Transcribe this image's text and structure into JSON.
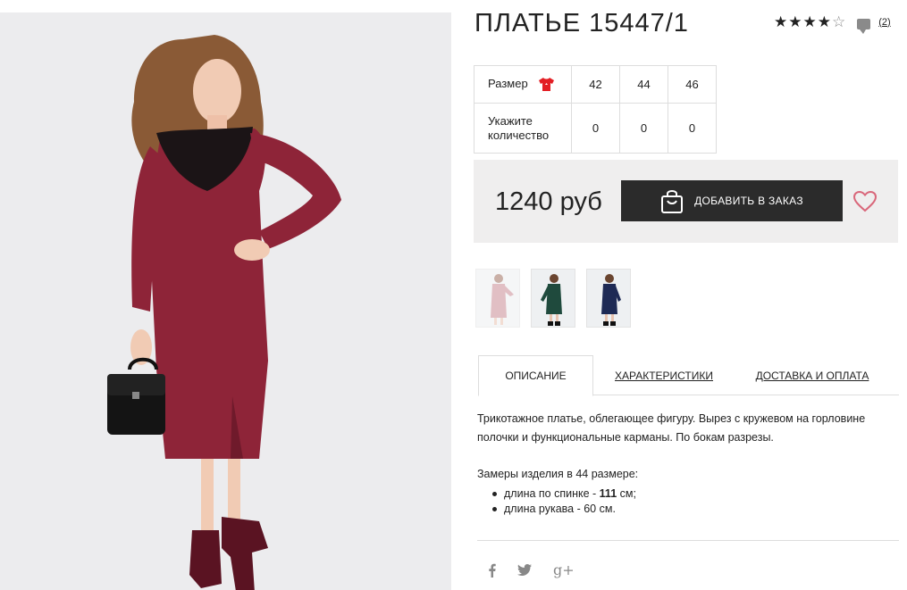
{
  "product": {
    "title": "ПЛАТЬЕ 15447/1",
    "rating": 4,
    "rating_max": 5,
    "review_count": "(2)"
  },
  "sizes": {
    "size_label": "Размер",
    "quantity_label_1": "Укажите",
    "quantity_label_2": "количество",
    "options": [
      {
        "size": "42",
        "qty": "0"
      },
      {
        "size": "44",
        "qty": "0"
      },
      {
        "size": "46",
        "qty": "0"
      }
    ]
  },
  "buy": {
    "price": "1240 руб",
    "add_label": "ДОБАВИТЬ В ЗАКАЗ"
  },
  "thumbnails": [
    {
      "color_name": "pink",
      "color": "#c98b95"
    },
    {
      "color_name": "green",
      "color": "#1f4a3d"
    },
    {
      "color_name": "navy",
      "color": "#1e2a55"
    }
  ],
  "tabs": {
    "description": "ОПИСАНИЕ",
    "characteristics": "ХАРАКТЕРИСТИКИ",
    "delivery": "ДОСТАВКА И ОПЛАТА"
  },
  "description": {
    "text": "Трикотажное платье, облегающее фигуру. Вырез с кружевом на горловине полочки и функциональные карманы. По бокам разрезы.",
    "measurements_title": "Замеры изделия в 44 размере:",
    "measurements": [
      {
        "prefix": "длина по спинке - ",
        "value": "111",
        "suffix": " см;"
      },
      {
        "prefix": "длина рукава - ",
        "value": "60",
        "suffix": " см."
      }
    ]
  },
  "social": {
    "facebook": "f",
    "twitter": "🐦",
    "gplus": "g+"
  },
  "colors": {
    "dress": "#8e2438",
    "button": "#2b2b2b",
    "heart": "#d9677a",
    "shirt_icon": "#e31e24"
  }
}
